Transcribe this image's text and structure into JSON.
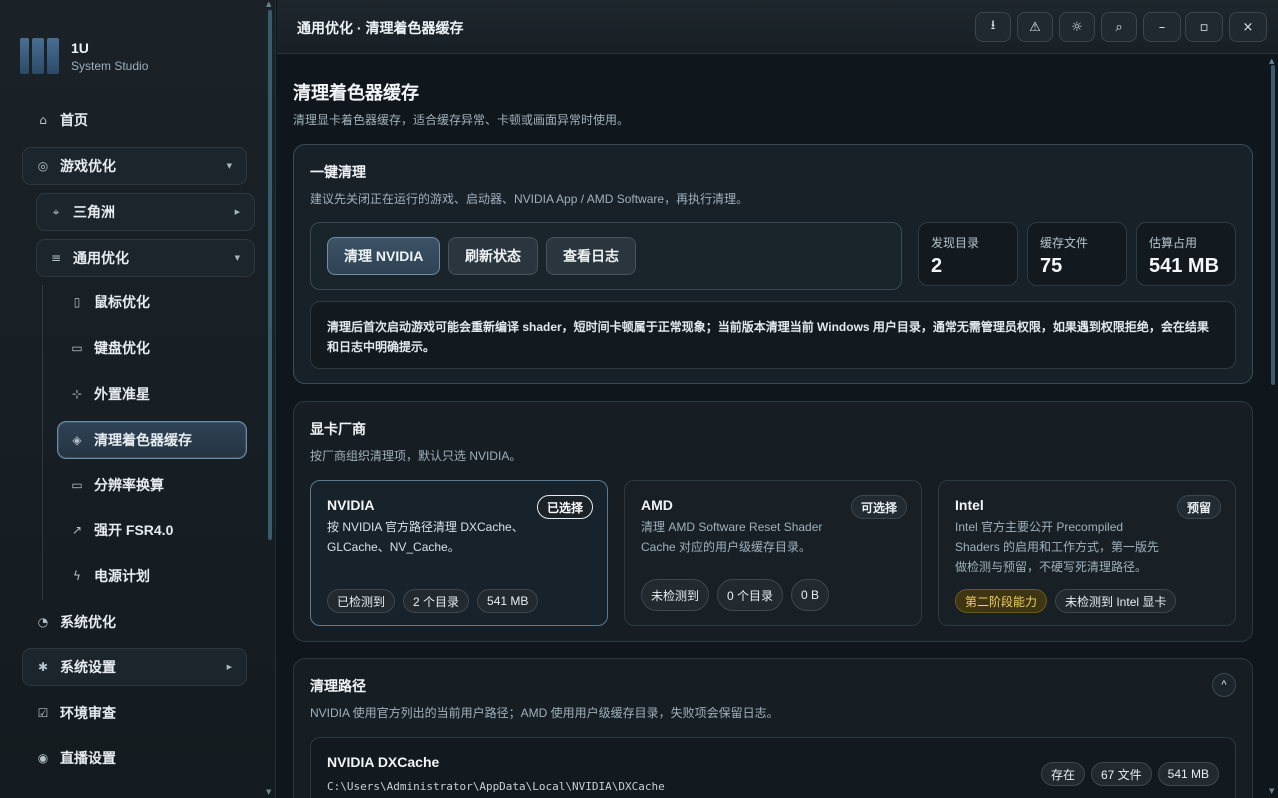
{
  "app": {
    "name": "1U",
    "subtitle": "System Studio"
  },
  "sidebar": {
    "home": "首页",
    "game_opt": "游戏优化",
    "delta": "三角洲",
    "general": "通用优化",
    "mouse": "鼠标优化",
    "keyboard": "键盘优化",
    "crosshair": "外置准星",
    "shader": "清理着色器缓存",
    "resolution": "分辨率换算",
    "fsr": "强开 FSR4.0",
    "power": "电源计划",
    "system_opt": "系统优化",
    "system_settings": "系统设置",
    "env_audit": "环境审查",
    "live": "直播设置"
  },
  "topbar": {
    "title": "通用优化 · 清理着色器缓存",
    "icons": [
      "download-icon",
      "alert-triangle-icon",
      "sun-icon",
      "search-icon",
      "minimize-icon",
      "maximize-icon",
      "close-icon"
    ]
  },
  "page": {
    "title": "清理着色器缓存",
    "desc": "清理显卡着色器缓存，适合缓存异常、卡顿或画面异常时使用。"
  },
  "oneclick": {
    "title": "一键清理",
    "desc": "建议先关闭正在运行的游戏、启动器、NVIDIA App / AMD Software，再执行清理。",
    "btn_clean": "清理 NVIDIA",
    "btn_refresh": "刷新状态",
    "btn_log": "查看日志",
    "stats": [
      {
        "label": "发现目录",
        "value": "2"
      },
      {
        "label": "缓存文件",
        "value": "75"
      },
      {
        "label": "估算占用",
        "value": "541 MB"
      }
    ],
    "note": "清理后首次启动游戏可能会重新编译 shader，短时间卡顿属于正常现象；当前版本清理当前 Windows 用户目录，通常无需管理员权限，如果遇到权限拒绝，会在结果和日志中明确提示。"
  },
  "vendors": {
    "title": "显卡厂商",
    "desc": "按厂商组织清理项，默认只选 NVIDIA。",
    "nvidia": {
      "name": "NVIDIA",
      "tag": "已选择",
      "desc": "按 NVIDIA 官方路径清理 DXCache、GLCache、NV_Cache。",
      "chips": [
        "已检测到",
        "2 个目录",
        "541 MB"
      ]
    },
    "amd": {
      "name": "AMD",
      "tag": "可选择",
      "desc": "清理 AMD Software Reset Shader Cache 对应的用户级缓存目录。",
      "chips": [
        "未检测到",
        "0 个目录",
        "0 B"
      ]
    },
    "intel": {
      "name": "Intel",
      "tag": "预留",
      "desc": "Intel 官方主要公开 Precompiled Shaders 的启用和工作方式，第一版先做检测与预留，不硬写死清理路径。",
      "chips": [
        "第二阶段能力",
        "未检测到 Intel 显卡"
      ]
    }
  },
  "paths": {
    "title": "清理路径",
    "desc": "NVIDIA 使用官方列出的当前用户路径；AMD 使用用户级缓存目录，失败项会保留日志。",
    "collapse": "^",
    "row": {
      "name": "NVIDIA DXCache",
      "path": "C:\\Users\\Administrator\\AppData\\Local\\NVIDIA\\DXCache",
      "chips": [
        "存在",
        "67 文件",
        "541 MB"
      ]
    }
  },
  "colors": {
    "accent": "#6d8ea8",
    "warn": "#f0d060",
    "bg": "#10171c"
  }
}
